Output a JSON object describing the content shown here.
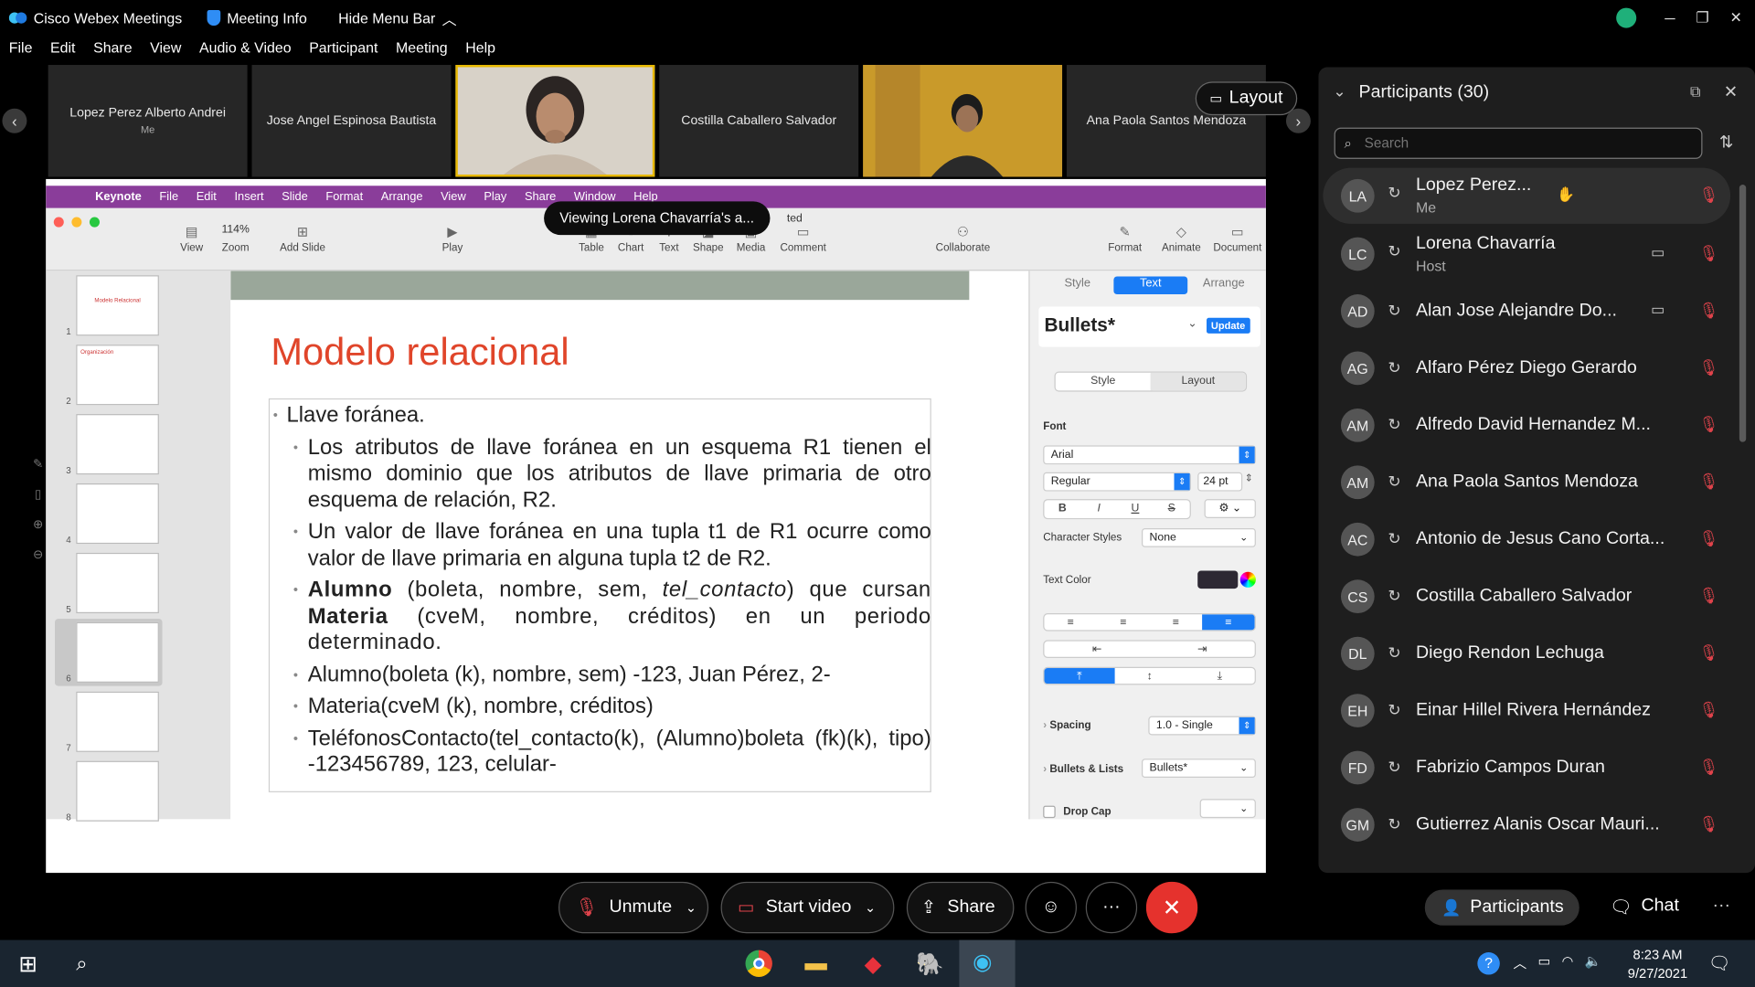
{
  "app": {
    "title": "Cisco Webex Meetings",
    "meeting_info": "Meeting Info",
    "hide_menu": "Hide Menu Bar"
  },
  "menu": [
    "File",
    "Edit",
    "Share",
    "View",
    "Audio & Video",
    "Participant",
    "Meeting",
    "Help"
  ],
  "tiles": [
    {
      "name": "Lopez Perez Alberto Andrei",
      "sub": "Me"
    },
    {
      "name": "Jose Angel Espinosa Bautista"
    },
    {
      "name": "Costilla Caballero Salvador"
    },
    {
      "name": "Ana Paola Santos Mendoza"
    }
  ],
  "layout_label": "Layout",
  "toast": "Viewing Lorena Chavarría's a...",
  "mac_menu": [
    "Keynote",
    "File",
    "Edit",
    "Insert",
    "Slide",
    "Format",
    "Arrange",
    "View",
    "Play",
    "Share",
    "Window",
    "Help"
  ],
  "toolbar": {
    "view": "View",
    "zoom_value": "114%",
    "zoom": "Zoom",
    "add_slide": "Add Slide",
    "play": "Play",
    "table": "Table",
    "chart": "Chart",
    "text": "Text",
    "shape": "Shape",
    "media": "Media",
    "comment": "Comment",
    "collaborate": "Collaborate",
    "format": "Format",
    "animate": "Animate",
    "document": "Document",
    "doc_suffix": "ted"
  },
  "thumbnail_numbers": [
    "1",
    "2",
    "3",
    "4",
    "5",
    "6",
    "7",
    "8"
  ],
  "thumbnail_titles": [
    "Modelo Relacional",
    "Organización"
  ],
  "slide": {
    "title": "Modelo relacional",
    "l1": "Llave foránea.",
    "b1": "Los atributos de llave foránea en un esquema R1 tienen el mismo dominio que los atributos de llave primaria de otro esquema de relación, R2.",
    "b2": "Un valor de llave foránea en una tupla t1 de R1 ocurre como valor de llave primaria en alguna tupla t2 de R2.",
    "b3_bold1": "Alumno",
    "b3_a": " (boleta, nombre, sem, ",
    "b3_it": "tel_contacto",
    "b3_b": ") que cursan ",
    "b3_bold2": "Materia",
    "b3_c": " (cveM, nombre, créditos) en un periodo determinado.",
    "b4": "Alumno(boleta (k), nombre, sem) -123, Juan Pérez, 2-",
    "b5": "Materia(cveM (k), nombre, créditos)",
    "b6": "TeléfonosContacto(tel_contacto(k), (Alumno)boleta (fk)(k), tipo) -123456789, 123, celular-"
  },
  "inspector": {
    "tabs": [
      "Style",
      "Text",
      "Arrange"
    ],
    "style_name": "Bullets*",
    "update": "Update",
    "sub_tabs": [
      "Style",
      "Layout"
    ],
    "font_label": "Font",
    "font": "Arial",
    "weight": "Regular",
    "size": "24 pt",
    "char_styles_label": "Character Styles",
    "char_styles": "None",
    "text_color_label": "Text Color",
    "spacing_label": "Spacing",
    "spacing": "1.0 - Single",
    "bullets_label": "Bullets & Lists",
    "bullets": "Bullets*",
    "drop_cap": "Drop Cap",
    "b": "B",
    "i": "I",
    "u": "U",
    "s": "S"
  },
  "participants": {
    "title": "Participants (30)",
    "search_placeholder": "Search",
    "list": [
      {
        "initials": "LA",
        "name": "Lopez Perez...",
        "role": "Me"
      },
      {
        "initials": "LC",
        "name": "Lorena Chavarría",
        "role": "Host"
      },
      {
        "initials": "AD",
        "name": "Alan Jose Alejandre Do..."
      },
      {
        "initials": "AG",
        "name": "Alfaro Pérez Diego Gerardo"
      },
      {
        "initials": "AM",
        "name": "Alfredo David Hernandez M..."
      },
      {
        "initials": "AM",
        "name": "Ana Paola Santos Mendoza"
      },
      {
        "initials": "AC",
        "name": "Antonio de Jesus Cano Corta..."
      },
      {
        "initials": "CS",
        "name": "Costilla Caballero Salvador"
      },
      {
        "initials": "DL",
        "name": "Diego Rendon Lechuga"
      },
      {
        "initials": "EH",
        "name": "Einar Hillel Rivera Hernández"
      },
      {
        "initials": "FD",
        "name": "Fabrizio Campos Duran"
      },
      {
        "initials": "GM",
        "name": "Gutierrez Alanis Oscar Mauri..."
      }
    ]
  },
  "controls": {
    "unmute": "Unmute",
    "start_video": "Start video",
    "share": "Share",
    "participants": "Participants",
    "chat": "Chat"
  },
  "clock": {
    "time": "8:23 AM",
    "date": "9/27/2021"
  },
  "colors": {
    "end_call": "#e5322d",
    "keynote_menu": "#8a3d9a",
    "slide_title": "#e0452a",
    "mic_muted": "#e0434b",
    "active_tab": "#1a7cf5"
  }
}
